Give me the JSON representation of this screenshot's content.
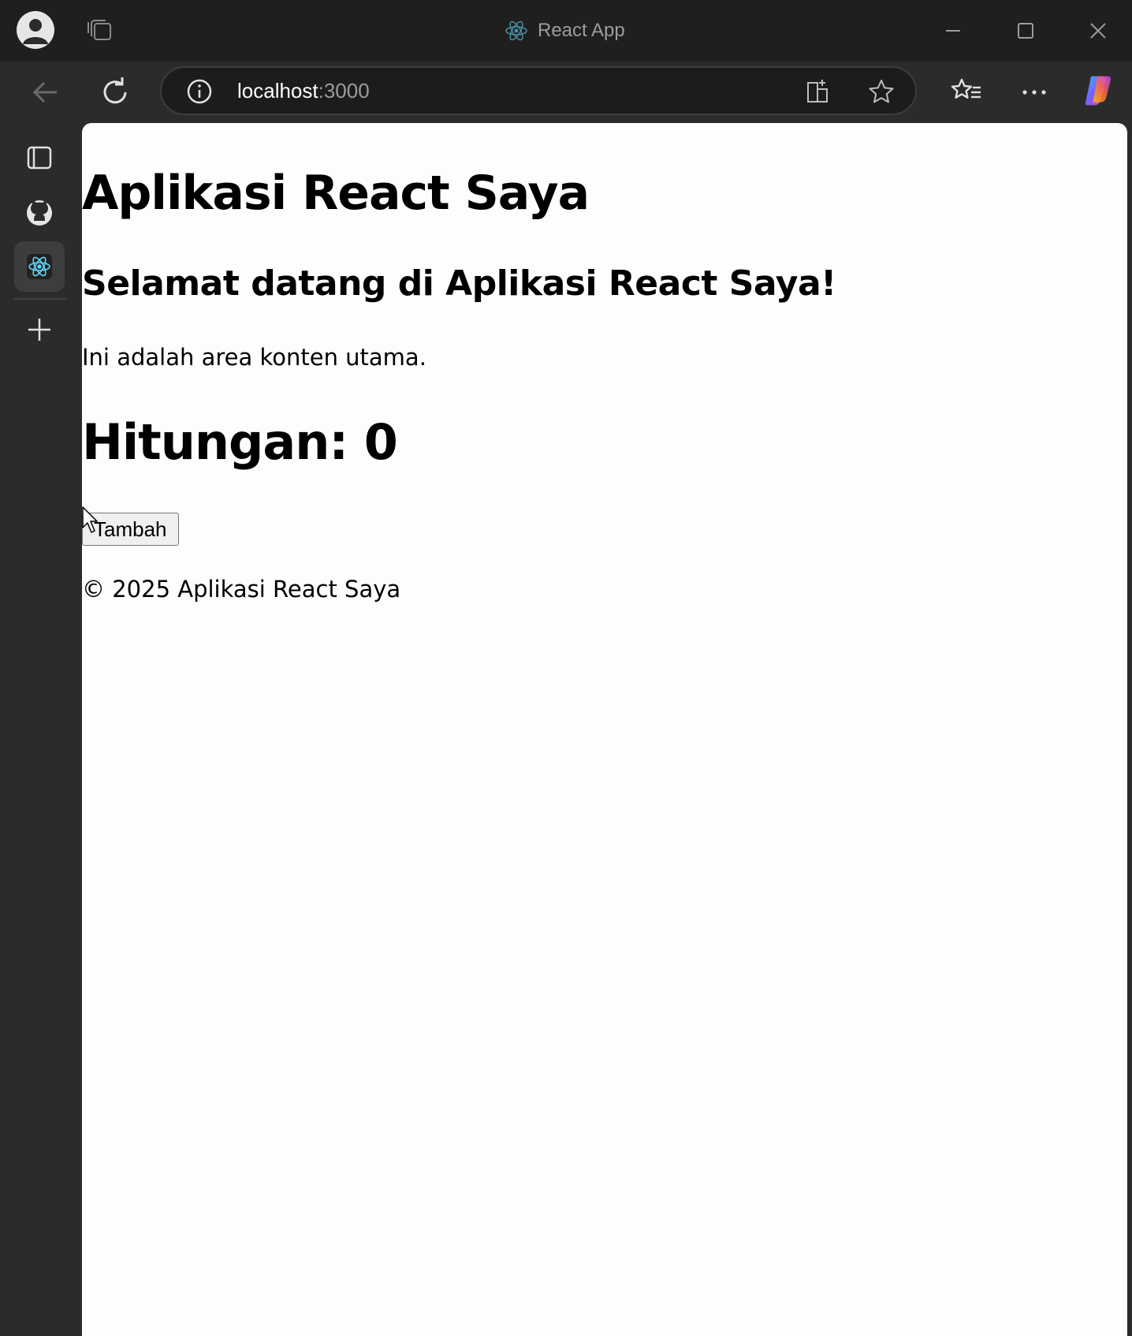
{
  "window": {
    "tab_title": "React App",
    "controls": [
      "minimize",
      "maximize",
      "close"
    ]
  },
  "toolbar": {
    "address_host": "localhost",
    "address_port": ":3000"
  },
  "sidebar": {
    "items": [
      {
        "name": "tab-actions",
        "icon": "tab-actions-icon"
      },
      {
        "name": "github",
        "icon": "github-icon"
      },
      {
        "name": "react-app",
        "icon": "react-icon",
        "active": true
      },
      {
        "name": "add",
        "icon": "plus-icon"
      }
    ]
  },
  "page": {
    "title": "Aplikasi React Saya",
    "welcome": "Selamat datang di Aplikasi React Saya!",
    "content": "Ini adalah area konten utama.",
    "counter_label": "Hitungan: 0",
    "add_button": "Tambah",
    "footer": "© 2025 Aplikasi React Saya"
  },
  "colors": {
    "titlebar": "#1f1f1f",
    "chrome": "#2b2b2b",
    "page_bg": "#fdfdfd",
    "react_accent": "#61dafb"
  }
}
